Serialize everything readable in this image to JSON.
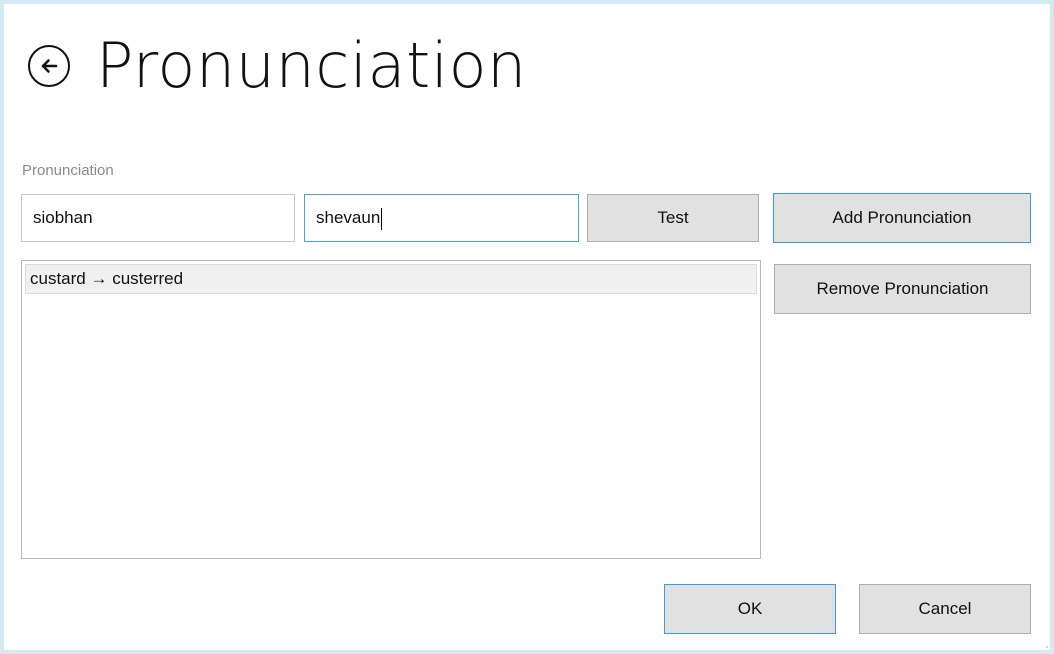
{
  "header": {
    "title": "Pronunciation",
    "back_icon": "back-arrow-icon"
  },
  "form": {
    "label": "Pronunciation",
    "word_value": "siobhan",
    "pronunciation_value": "shevaun",
    "test_label": "Test"
  },
  "actions": {
    "add_label": "Add Pronunciation",
    "remove_label": "Remove Pronunciation"
  },
  "list": {
    "items": [
      {
        "text": "custard → custerred"
      }
    ]
  },
  "footer": {
    "ok_label": "OK",
    "cancel_label": "Cancel"
  },
  "colors": {
    "background": "#d3e9f3",
    "focus_border": "#4aa0e0",
    "button_face": "#e1e1e1"
  }
}
